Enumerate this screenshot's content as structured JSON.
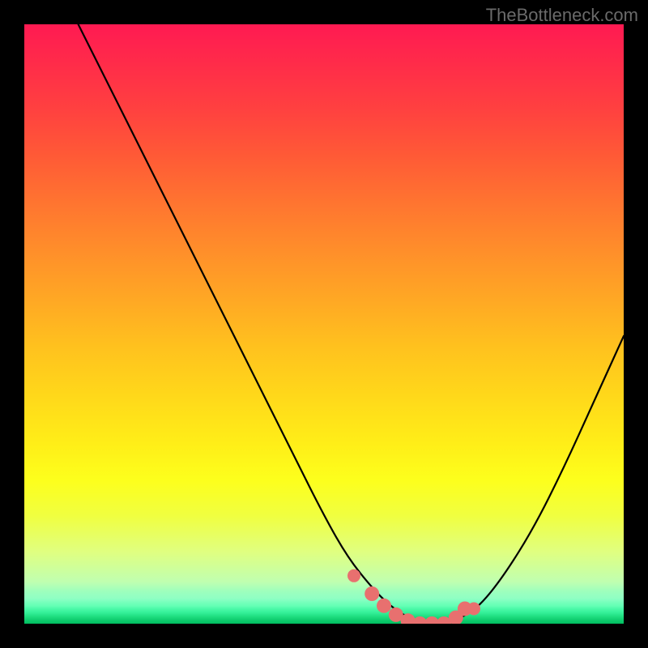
{
  "watermark": "TheBottleneck.com",
  "colors": {
    "background": "#000000",
    "watermark_text": "#6a6a6a",
    "curve_stroke": "#000000",
    "marker_fill": "#e8706f",
    "marker_stroke": "#d85a5a"
  },
  "chart_data": {
    "type": "line",
    "title": "",
    "xlabel": "",
    "ylabel": "",
    "xlim": [
      0,
      100
    ],
    "ylim": [
      0,
      100
    ],
    "grid": false,
    "note": "No axis ticks or numeric labels are visible; values are normalized 0-100 estimates read from pixel position. y=0 is the top (red, high bottleneck), y=100 is the bottom (green, optimal).",
    "series": [
      {
        "name": "bottleneck_curve",
        "x": [
          9,
          14,
          20,
          26,
          32,
          38,
          44,
          50,
          54,
          58,
          61,
          64,
          67,
          70,
          73,
          76,
          80,
          85,
          90,
          95,
          100
        ],
        "y": [
          0,
          10,
          22,
          34,
          46,
          58,
          70,
          82,
          89,
          94,
          97,
          99,
          100,
          100,
          99,
          97,
          92,
          84,
          74,
          63,
          52
        ]
      }
    ],
    "markers": {
      "name": "highlighted_optimal_region",
      "x": [
        55,
        58,
        60,
        62,
        64,
        66,
        68,
        70,
        72,
        73.5,
        75
      ],
      "y": [
        92,
        95,
        97,
        98.5,
        99.5,
        100,
        100,
        100,
        99,
        97.5,
        97.5
      ]
    },
    "background_gradient": {
      "orientation": "vertical",
      "stops": [
        {
          "pos": 0.0,
          "color": "#ff1a52"
        },
        {
          "pos": 0.22,
          "color": "#ff5a36"
        },
        {
          "pos": 0.46,
          "color": "#ffa824"
        },
        {
          "pos": 0.7,
          "color": "#ffee18"
        },
        {
          "pos": 0.88,
          "color": "#e0ff80"
        },
        {
          "pos": 1.0,
          "color": "#00c060"
        }
      ]
    }
  }
}
